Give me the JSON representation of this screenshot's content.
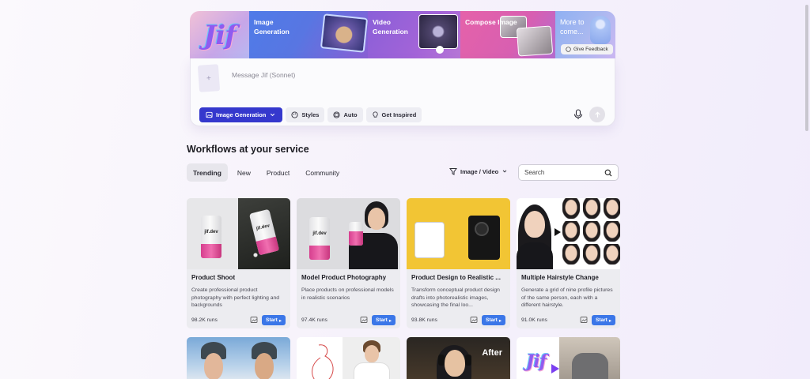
{
  "banner": {
    "logo": "Jif",
    "tiles": [
      {
        "label": "Image Generation"
      },
      {
        "label": "Video Generation"
      },
      {
        "label": "Compose Image"
      },
      {
        "label": "More to come..."
      }
    ],
    "feedback_label": "Give Feedback"
  },
  "composer": {
    "placeholder": "Message Jif (Sonnet)",
    "mode_label": "Image Generation",
    "styles_label": "Styles",
    "auto_label": "Auto",
    "inspired_label": "Get Inspired"
  },
  "workflows": {
    "title": "Workflows at your service",
    "tabs": [
      "Trending",
      "New",
      "Product",
      "Community"
    ],
    "filter_label": "Image / Video",
    "search_placeholder": "Search",
    "start_label": "Start",
    "cards": [
      {
        "title": "Product Shoot",
        "desc": "Create professional product photography with perfect lighting and backgrounds",
        "runs": "98.2K runs"
      },
      {
        "title": "Model Product Photography",
        "desc": "Place products on professional models in realistic scenarios",
        "runs": "97.4K runs"
      },
      {
        "title": "Product Design to Realistic ...",
        "desc": "Transform conceptual product design drafts into photorealistic images, showcasing the final loo...",
        "runs": "93.8K runs"
      },
      {
        "title": "Multiple Hairstyle Change",
        "desc": "Generate a grid of nine profile pictures of the same person, each with a different hairstyle.",
        "runs": "91.0K runs"
      }
    ],
    "row2_overlay_after": "After",
    "row2_logo": "Jif"
  },
  "colors": {
    "primary": "#3538cd",
    "start_button": "#3b77e8",
    "card_bg": "#ececf0"
  }
}
